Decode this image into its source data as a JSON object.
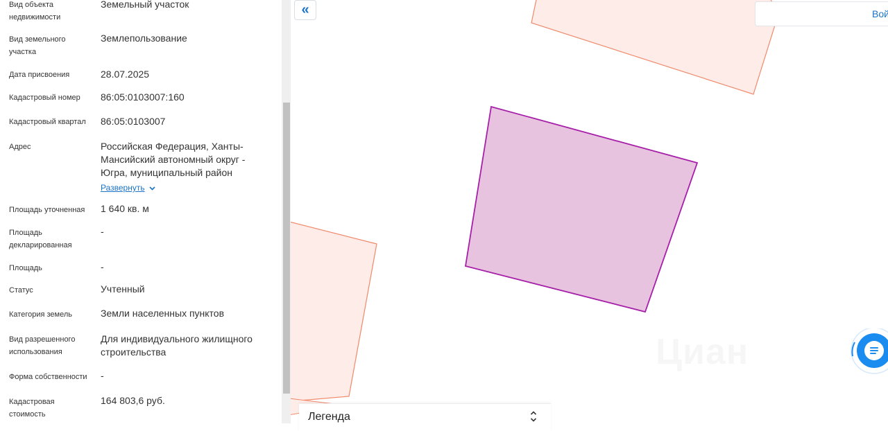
{
  "attributes": [
    {
      "label": "Вид объекта недвижимости",
      "value": "Земельный участок"
    },
    {
      "label": "Вид земельного участка",
      "value": "Землепользование"
    },
    {
      "label": "Дата присвоения",
      "value": "28.07.2025"
    },
    {
      "label": "Кадастровый номер",
      "value": "86:05:0103007:160"
    },
    {
      "label": "Кадастровый квартал",
      "value": "86:05:0103007"
    },
    {
      "label": "Адрес",
      "value": "Российская Федерация, Ханты-Мансийский автономный округ - Югра, муниципальный район"
    },
    {
      "label": "Площадь уточненная",
      "value": "1 640 кв. м"
    },
    {
      "label": "Площадь декларированная",
      "value": "-"
    },
    {
      "label": "Площадь",
      "value": "-"
    },
    {
      "label": "Статус",
      "value": "Учтенный"
    },
    {
      "label": "Категория земель",
      "value": "Земли населенных пунктов"
    },
    {
      "label": "Вид разрешенного использования",
      "value": "Для индивидуального жилищного строительства"
    },
    {
      "label": "Форма собственности",
      "value": "-"
    },
    {
      "label": "Кадастровая стоимость",
      "value": "164 803,6 руб."
    }
  ],
  "address_expand": "Развернуть",
  "map": {
    "collapse_glyph": "«",
    "login_label": "Войти",
    "legend_title": "Легенда",
    "watermark": "Циан",
    "colors": {
      "selected_fill": "#e8c3e0",
      "selected_stroke": "#a61fa8",
      "parcel_fill": "#fdece8",
      "parcel_stroke": "#f0896a",
      "accent": "#1a73c8"
    }
  }
}
